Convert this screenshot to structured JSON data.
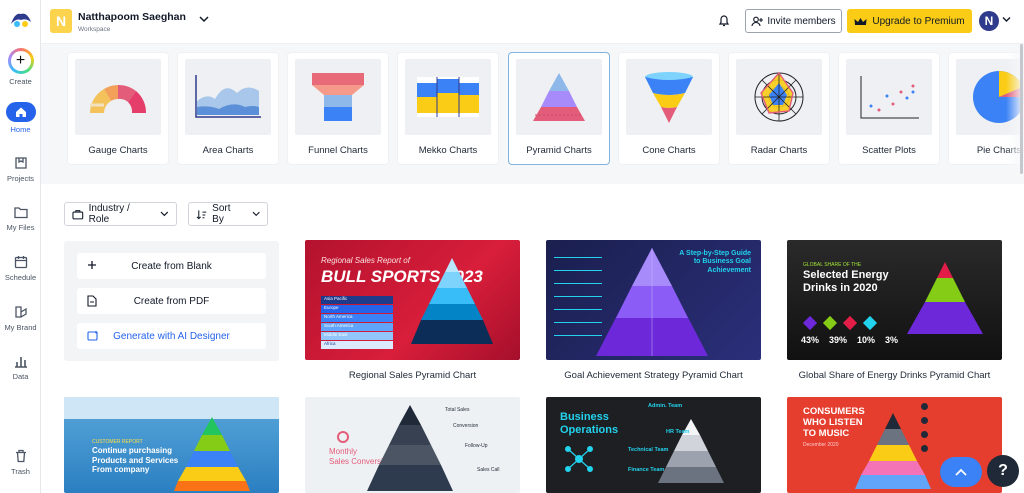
{
  "workspace": {
    "initial": "N",
    "name": "Natthapoom Saeghan",
    "subtitle": "Workspace"
  },
  "header": {
    "invite_label": "Invite members",
    "upgrade_label": "Upgrade to Premium",
    "user_initial": "N"
  },
  "rail": {
    "create": "Create",
    "home": "Home",
    "projects": "Projects",
    "files": "My Files",
    "schedule": "Schedule",
    "brand": "My Brand",
    "data": "Data",
    "trash": "Trash"
  },
  "categories": [
    {
      "label": "Gauge Charts",
      "icon": "gauge-chart-icon"
    },
    {
      "label": "Area Charts",
      "icon": "area-chart-icon"
    },
    {
      "label": "Funnel Charts",
      "icon": "funnel-chart-icon"
    },
    {
      "label": "Mekko Charts",
      "icon": "mekko-chart-icon"
    },
    {
      "label": "Pyramid Charts",
      "icon": "pyramid-chart-icon"
    },
    {
      "label": "Cone Charts",
      "icon": "cone-chart-icon"
    },
    {
      "label": "Radar Charts",
      "icon": "radar-chart-icon"
    },
    {
      "label": "Scatter Plots",
      "icon": "scatter-plot-icon"
    },
    {
      "label": "Pie Charts",
      "icon": "pie-chart-icon"
    }
  ],
  "selected_category": "Pyramid Charts",
  "filters": {
    "industry": "Industry / Role",
    "sort": "Sort By"
  },
  "create_panel": {
    "blank": "Create from Blank",
    "pdf": "Create from PDF",
    "ai": "Generate with AI Designer"
  },
  "templates": [
    {
      "caption": "Regional Sales Pyramid Chart",
      "title_line1": "Regional Sales Report of",
      "title_line2": "BULL SPORTS 2023",
      "rows": [
        "Asia Pacific",
        "Europe",
        "North America",
        "South America",
        "Middle East",
        "Africa"
      ]
    },
    {
      "caption": "Goal Achievement Strategy Pyramid Chart",
      "title": "A Step-by-Step Guide to Business Goal Achievement"
    },
    {
      "caption": "Global Share of Energy Drinks Pyramid Chart",
      "title_small": "GLOBAL SHARE OF THE",
      "title_line1": "Selected Energy",
      "title_line2": "Drinks in 2020",
      "stats": [
        "43%",
        "39%",
        "10%",
        "3%"
      ]
    },
    {
      "caption": "",
      "eyebrow": "CUSTOMER REPORT",
      "title": "Continue purchasing Products and Services From company"
    },
    {
      "caption": "",
      "title_line1": "Monthly",
      "title_line2": "Sales Conversion",
      "labels": [
        "Total Sales",
        "Conversion",
        "Follow-Up",
        "Sales Call"
      ]
    },
    {
      "caption": "",
      "title_line1": "Business",
      "title_line2": "Operations",
      "labels": [
        "Admin. Team",
        "HR Team",
        "Technical Team",
        "Finance Team"
      ]
    },
    {
      "caption": "",
      "title_line1": "CONSUMERS",
      "title_line2": "WHO LISTEN",
      "title_line3": "TO MUSIC",
      "date": "December 2020"
    }
  ],
  "help_label": "?"
}
